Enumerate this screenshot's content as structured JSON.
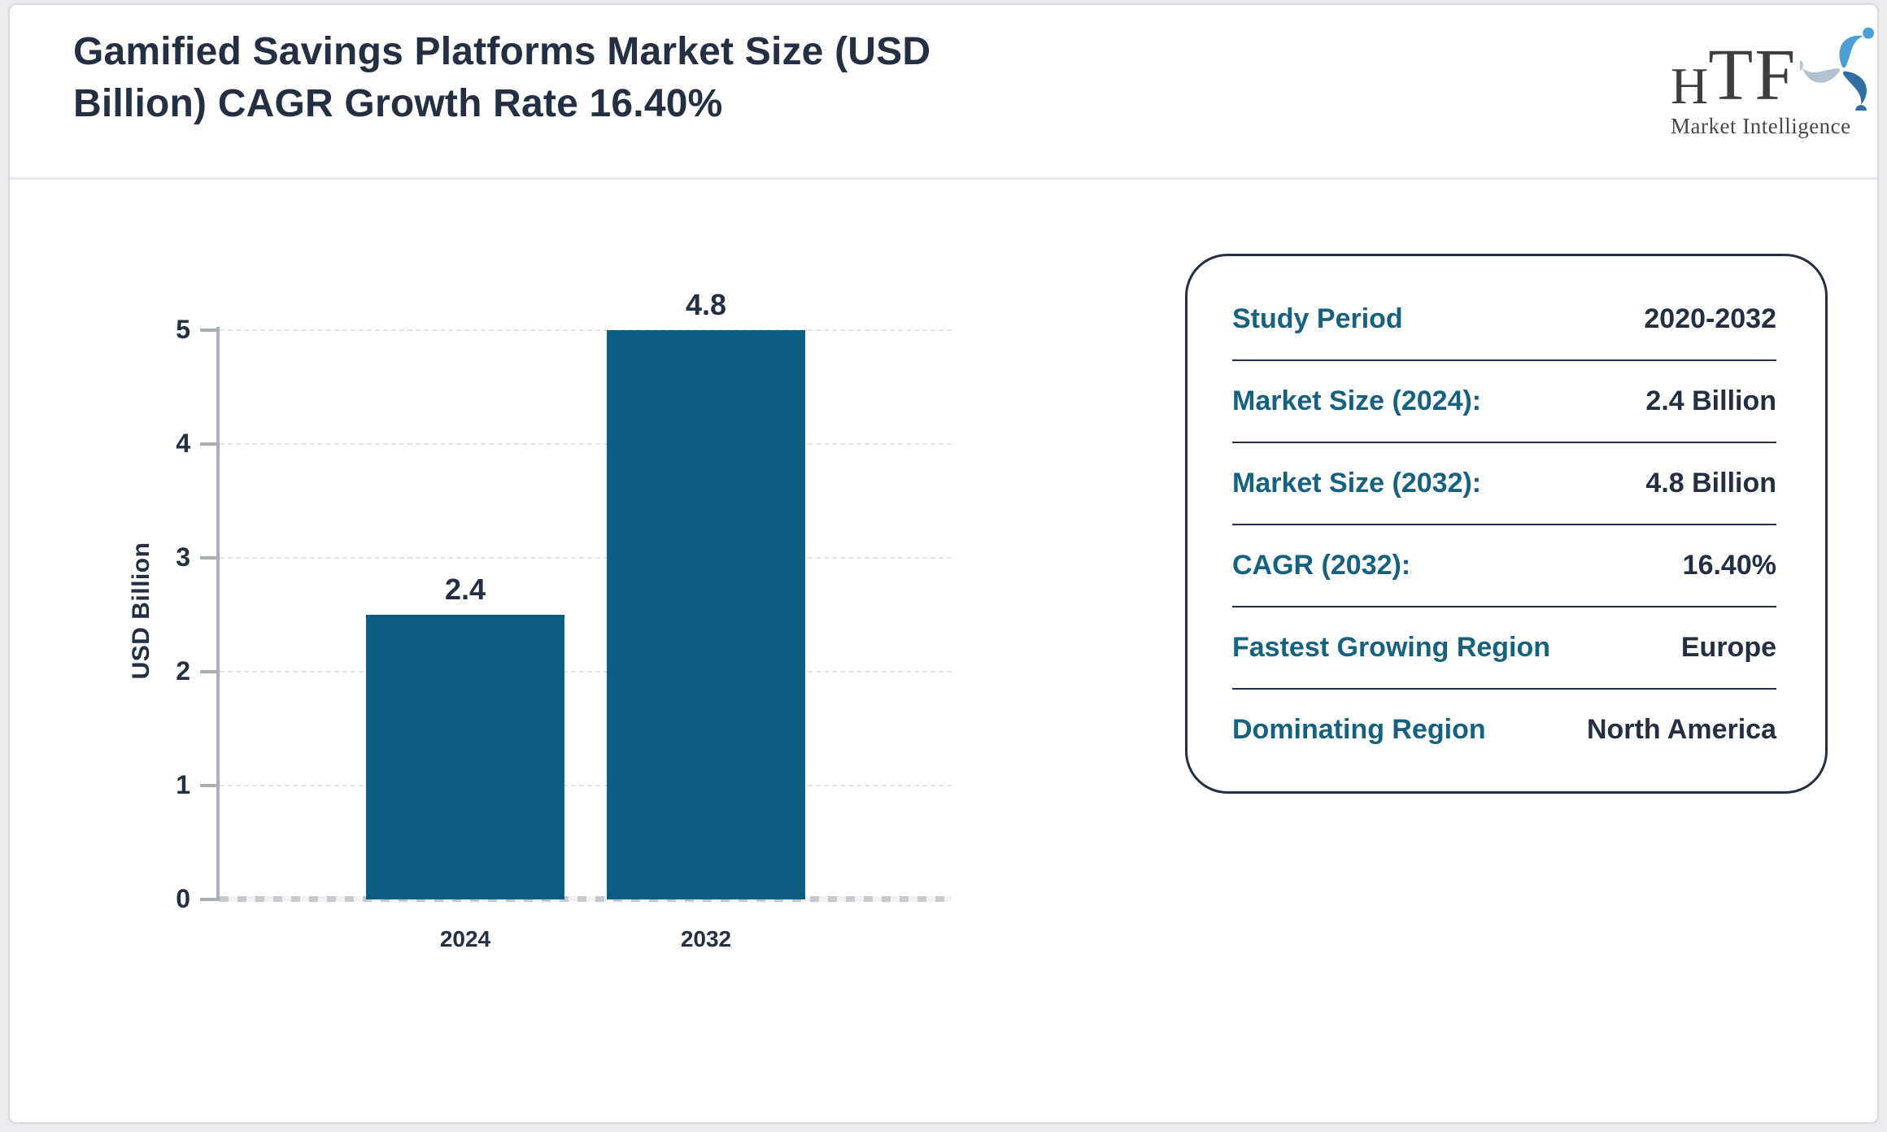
{
  "header": {
    "title": "Gamified Savings Platforms Market Size (USD Billion) CAGR Growth Rate 16.40%",
    "logo": {
      "text_h": "H",
      "text_tf": "TF",
      "subtext": "Market Intelligence"
    }
  },
  "chart_data": {
    "type": "bar",
    "title": "Gamified Savings Platforms Market Size (USD Billion) CAGR Growth Rate 16.40%",
    "categories": [
      "2024",
      "2032"
    ],
    "values": [
      2.4,
      4.8
    ],
    "bar_labels": [
      "2.4",
      "4.8"
    ],
    "xlabel": "",
    "ylabel": "USD Billion",
    "ylim": [
      0,
      5
    ],
    "yticks": [
      0,
      1,
      2,
      3,
      4,
      5
    ],
    "grid": "horizontal-dashed",
    "legend": "none",
    "bar_color": "#0d5d82"
  },
  "info_panel": {
    "rows": [
      {
        "label": "Study Period",
        "value": "2020-2032"
      },
      {
        "label": "Market Size (2024):",
        "value": "2.4 Billion"
      },
      {
        "label": "Market Size (2032):",
        "value": "4.8 Billion"
      },
      {
        "label": "CAGR (2032):",
        "value": "16.40%"
      },
      {
        "label": "Fastest Growing Region",
        "value": "Europe"
      },
      {
        "label": "Dominating Region",
        "value": "North America"
      }
    ]
  },
  "colors": {
    "bar": "#0d5d82",
    "label_teal": "#16617f",
    "text_navy": "#233043",
    "axis_gray": "#a9aeb8"
  }
}
